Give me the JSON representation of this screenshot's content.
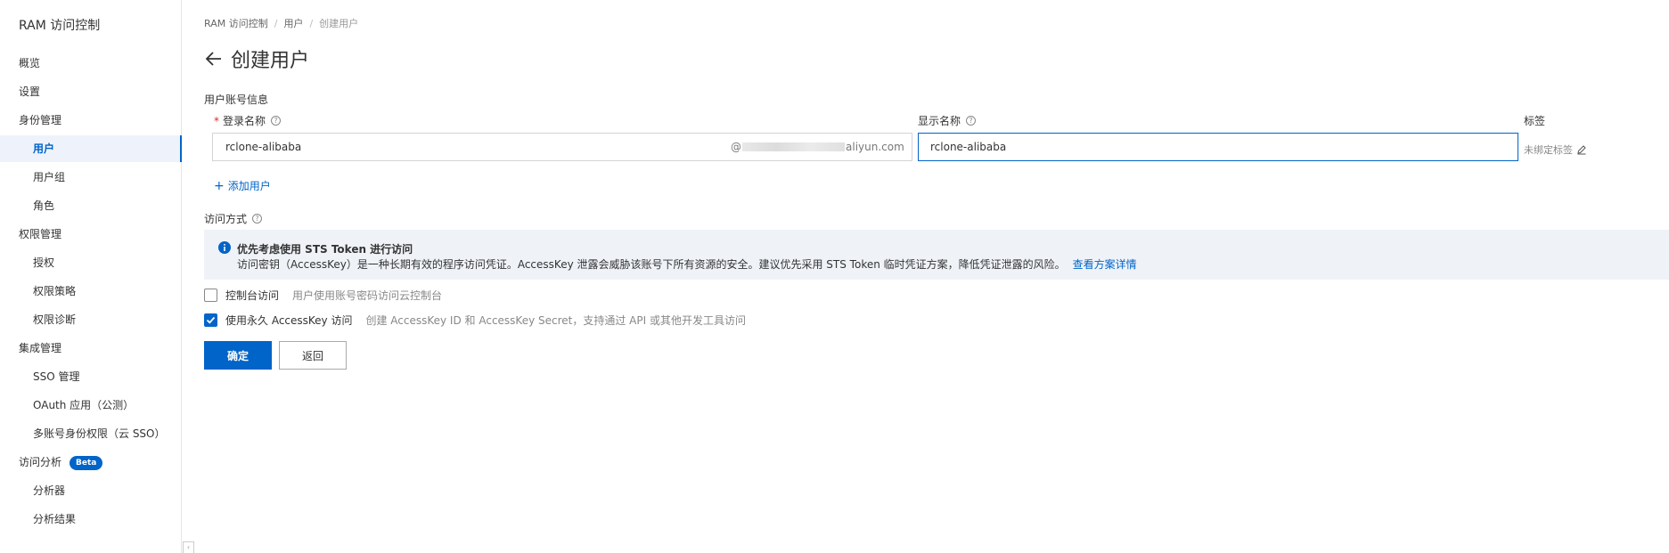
{
  "sidebar": {
    "title": "RAM 访问控制",
    "items": [
      {
        "label": "概览"
      },
      {
        "label": "设置"
      },
      {
        "label": "身份管理"
      },
      {
        "label": "用户"
      },
      {
        "label": "用户组"
      },
      {
        "label": "角色"
      },
      {
        "label": "权限管理"
      },
      {
        "label": "授权"
      },
      {
        "label": "权限策略"
      },
      {
        "label": "权限诊断"
      },
      {
        "label": "集成管理"
      },
      {
        "label": "SSO 管理"
      },
      {
        "label": "OAuth 应用（公测）"
      },
      {
        "label": "多账号身份权限（云 SSO）"
      },
      {
        "label": "访问分析"
      },
      {
        "label": "分析器"
      },
      {
        "label": "分析结果"
      }
    ],
    "beta_badge": "Beta"
  },
  "breadcrumb": [
    "RAM 访问控制",
    "用户",
    "创建用户"
  ],
  "page_title": "创建用户",
  "form": {
    "section": "用户账号信息",
    "login_name_label": "登录名称",
    "login_name_value": "rclone-alibaba",
    "login_suffix_at": "@",
    "login_suffix_domain": "aliyun.com",
    "display_name_label": "显示名称",
    "display_name_value": "rclone-alibaba",
    "tag_label": "标签",
    "tag_empty": "未绑定标签",
    "add_user": "添加用户",
    "access_label": "访问方式"
  },
  "alert": {
    "title": "优先考虑使用 STS Token 进行访问",
    "desc": "访问密钥（AccessKey）是一种长期有效的程序访问凭证。AccessKey 泄露会威胁该账号下所有资源的安全。建议优先采用 STS Token 临时凭证方案，降低凭证泄露的风险。",
    "link": "查看方案详情"
  },
  "options": {
    "console": {
      "label": "控制台访问",
      "desc": "用户使用账号密码访问云控制台",
      "checked": false
    },
    "accesskey": {
      "label": "使用永久 AccessKey 访问",
      "desc": "创建 AccessKey ID 和 AccessKey Secret，支持通过 API 或其他开发工具访问",
      "checked": true
    }
  },
  "buttons": {
    "confirm": "确定",
    "back": "返回"
  },
  "colors": {
    "primary": "#0064c8",
    "alert_bg": "#eff3f8"
  }
}
